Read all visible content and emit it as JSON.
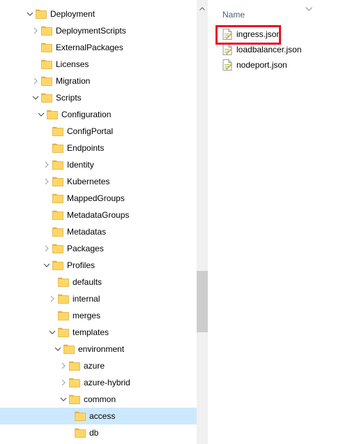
{
  "navigation_tree": {
    "items": [
      {
        "label": "Deployment",
        "depth": 0,
        "state": "expanded"
      },
      {
        "label": "DeploymentScripts",
        "depth": 1,
        "state": "collapsed"
      },
      {
        "label": "ExternalPackages",
        "depth": 1,
        "state": "none"
      },
      {
        "label": "Licenses",
        "depth": 1,
        "state": "none"
      },
      {
        "label": "Migration",
        "depth": 1,
        "state": "collapsed"
      },
      {
        "label": "Scripts",
        "depth": 1,
        "state": "expanded"
      },
      {
        "label": "Configuration",
        "depth": 2,
        "state": "expanded"
      },
      {
        "label": "ConfigPortal",
        "depth": 3,
        "state": "none"
      },
      {
        "label": "Endpoints",
        "depth": 3,
        "state": "none"
      },
      {
        "label": "Identity",
        "depth": 3,
        "state": "collapsed"
      },
      {
        "label": "Kubernetes",
        "depth": 3,
        "state": "collapsed"
      },
      {
        "label": "MappedGroups",
        "depth": 3,
        "state": "none"
      },
      {
        "label": "MetadataGroups",
        "depth": 3,
        "state": "none"
      },
      {
        "label": "Metadatas",
        "depth": 3,
        "state": "none"
      },
      {
        "label": "Packages",
        "depth": 3,
        "state": "collapsed"
      },
      {
        "label": "Profiles",
        "depth": 3,
        "state": "expanded"
      },
      {
        "label": "defaults",
        "depth": 4,
        "state": "none"
      },
      {
        "label": "internal",
        "depth": 4,
        "state": "collapsed"
      },
      {
        "label": "merges",
        "depth": 4,
        "state": "none"
      },
      {
        "label": "templates",
        "depth": 4,
        "state": "expanded"
      },
      {
        "label": "environment",
        "depth": 5,
        "state": "expanded"
      },
      {
        "label": "azure",
        "depth": 6,
        "state": "collapsed"
      },
      {
        "label": "azure-hybrid",
        "depth": 6,
        "state": "collapsed"
      },
      {
        "label": "common",
        "depth": 6,
        "state": "expanded"
      },
      {
        "label": "access",
        "depth": 7,
        "state": "none",
        "selected": true
      },
      {
        "label": "db",
        "depth": 7,
        "state": "none"
      }
    ]
  },
  "file_list": {
    "column_header": "Name",
    "files": [
      {
        "name": "ingress.json",
        "highlighted": true
      },
      {
        "name": "loadbalancer.json",
        "highlighted": false
      },
      {
        "name": "nodeport.json",
        "highlighted": false
      }
    ]
  },
  "colors": {
    "selection": "#cce8ff",
    "highlight_border": "#e81123",
    "folder": "#ffd767"
  }
}
